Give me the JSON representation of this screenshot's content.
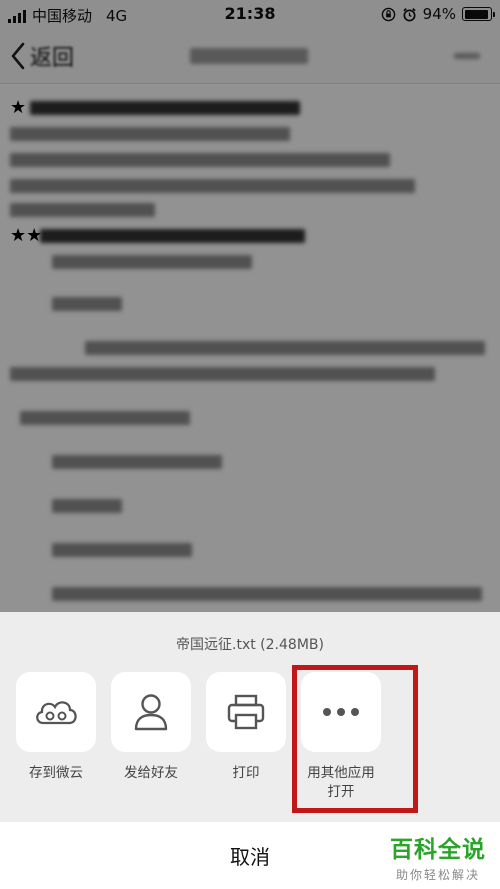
{
  "status_bar": {
    "carrier": "中国移动",
    "network": "4G",
    "time": "21:38",
    "battery_percent": "94%",
    "battery_level": 0.94,
    "icons": [
      "signal-icon",
      "orientation-lock-icon",
      "alarm-icon",
      "battery-icon"
    ]
  },
  "nav": {
    "back_label": "返回",
    "back_icon": "chevron-left-icon",
    "more_icon": "more-icon"
  },
  "share_sheet": {
    "file_name": "帝国远征.txt (2.48MB)",
    "items": [
      {
        "label": "存到微云",
        "icon": "cloud-icon"
      },
      {
        "label": "发给好友",
        "icon": "person-icon"
      },
      {
        "label": "打印",
        "icon": "printer-icon"
      },
      {
        "label": "用其他应用\n打开",
        "icon": "more-dots-icon"
      }
    ],
    "cancel_label": "取消",
    "highlight_color": "#c01818"
  },
  "watermark": {
    "title": "百科全说",
    "subtitle": "助你轻松解决",
    "color": "#2aa52a"
  }
}
